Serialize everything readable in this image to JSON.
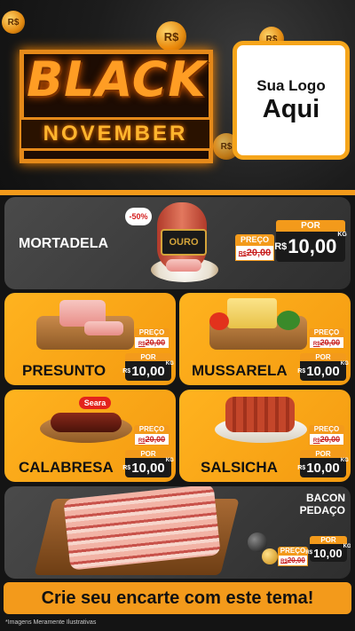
{
  "header": {
    "title_line1": "BLACK",
    "title_line2": "NOVEMBER",
    "coin_symbol": "R$",
    "logo_line1": "Sua Logo",
    "logo_line2": "Aqui"
  },
  "featured": {
    "name": "MORTADELA",
    "discount_badge": "-50%",
    "brand": "OURO",
    "de_label": "PREÇO",
    "de_prefix": "R$",
    "de_value": "20,00",
    "por_label": "POR",
    "por_currency": "R$",
    "por_value": "10,00",
    "unit": "KG"
  },
  "products": [
    {
      "name": "PRESUNTO",
      "de_label": "PREÇO",
      "de_prefix": "R$",
      "de_value": "20,00",
      "por_label": "POR",
      "por_currency": "R$",
      "por_value": "10,00",
      "unit": "KG"
    },
    {
      "name": "MUSSARELA",
      "de_label": "PREÇO",
      "de_prefix": "R$",
      "de_value": "20,00",
      "por_label": "POR",
      "por_currency": "R$",
      "por_value": "10,00",
      "unit": "KG"
    },
    {
      "name": "CALABRESA",
      "brand": "Seara",
      "de_label": "PREÇO",
      "de_prefix": "R$",
      "de_value": "20,00",
      "por_label": "POR",
      "por_currency": "R$",
      "por_value": "10,00",
      "unit": "KG"
    },
    {
      "name": "SALSICHA",
      "de_label": "PREÇO",
      "de_prefix": "R$",
      "de_value": "20,00",
      "por_label": "POR",
      "por_currency": "R$",
      "por_value": "10,00",
      "unit": "KG"
    }
  ],
  "bacon": {
    "name_line1": "BACON",
    "name_line2": "PEDAÇO",
    "de_label": "PREÇO",
    "de_prefix": "R$",
    "de_value": "20,00",
    "por_label": "POR",
    "por_currency": "R$",
    "por_value": "10,00",
    "unit": "KG"
  },
  "footer": {
    "cta": "Crie seu encarte com este tema!",
    "disclaimer": "*Imagens Meramente Ilustrativas"
  },
  "colors": {
    "accent": "#f39a1b",
    "panel_gray": "#3c3c3c",
    "background": "#141414"
  }
}
